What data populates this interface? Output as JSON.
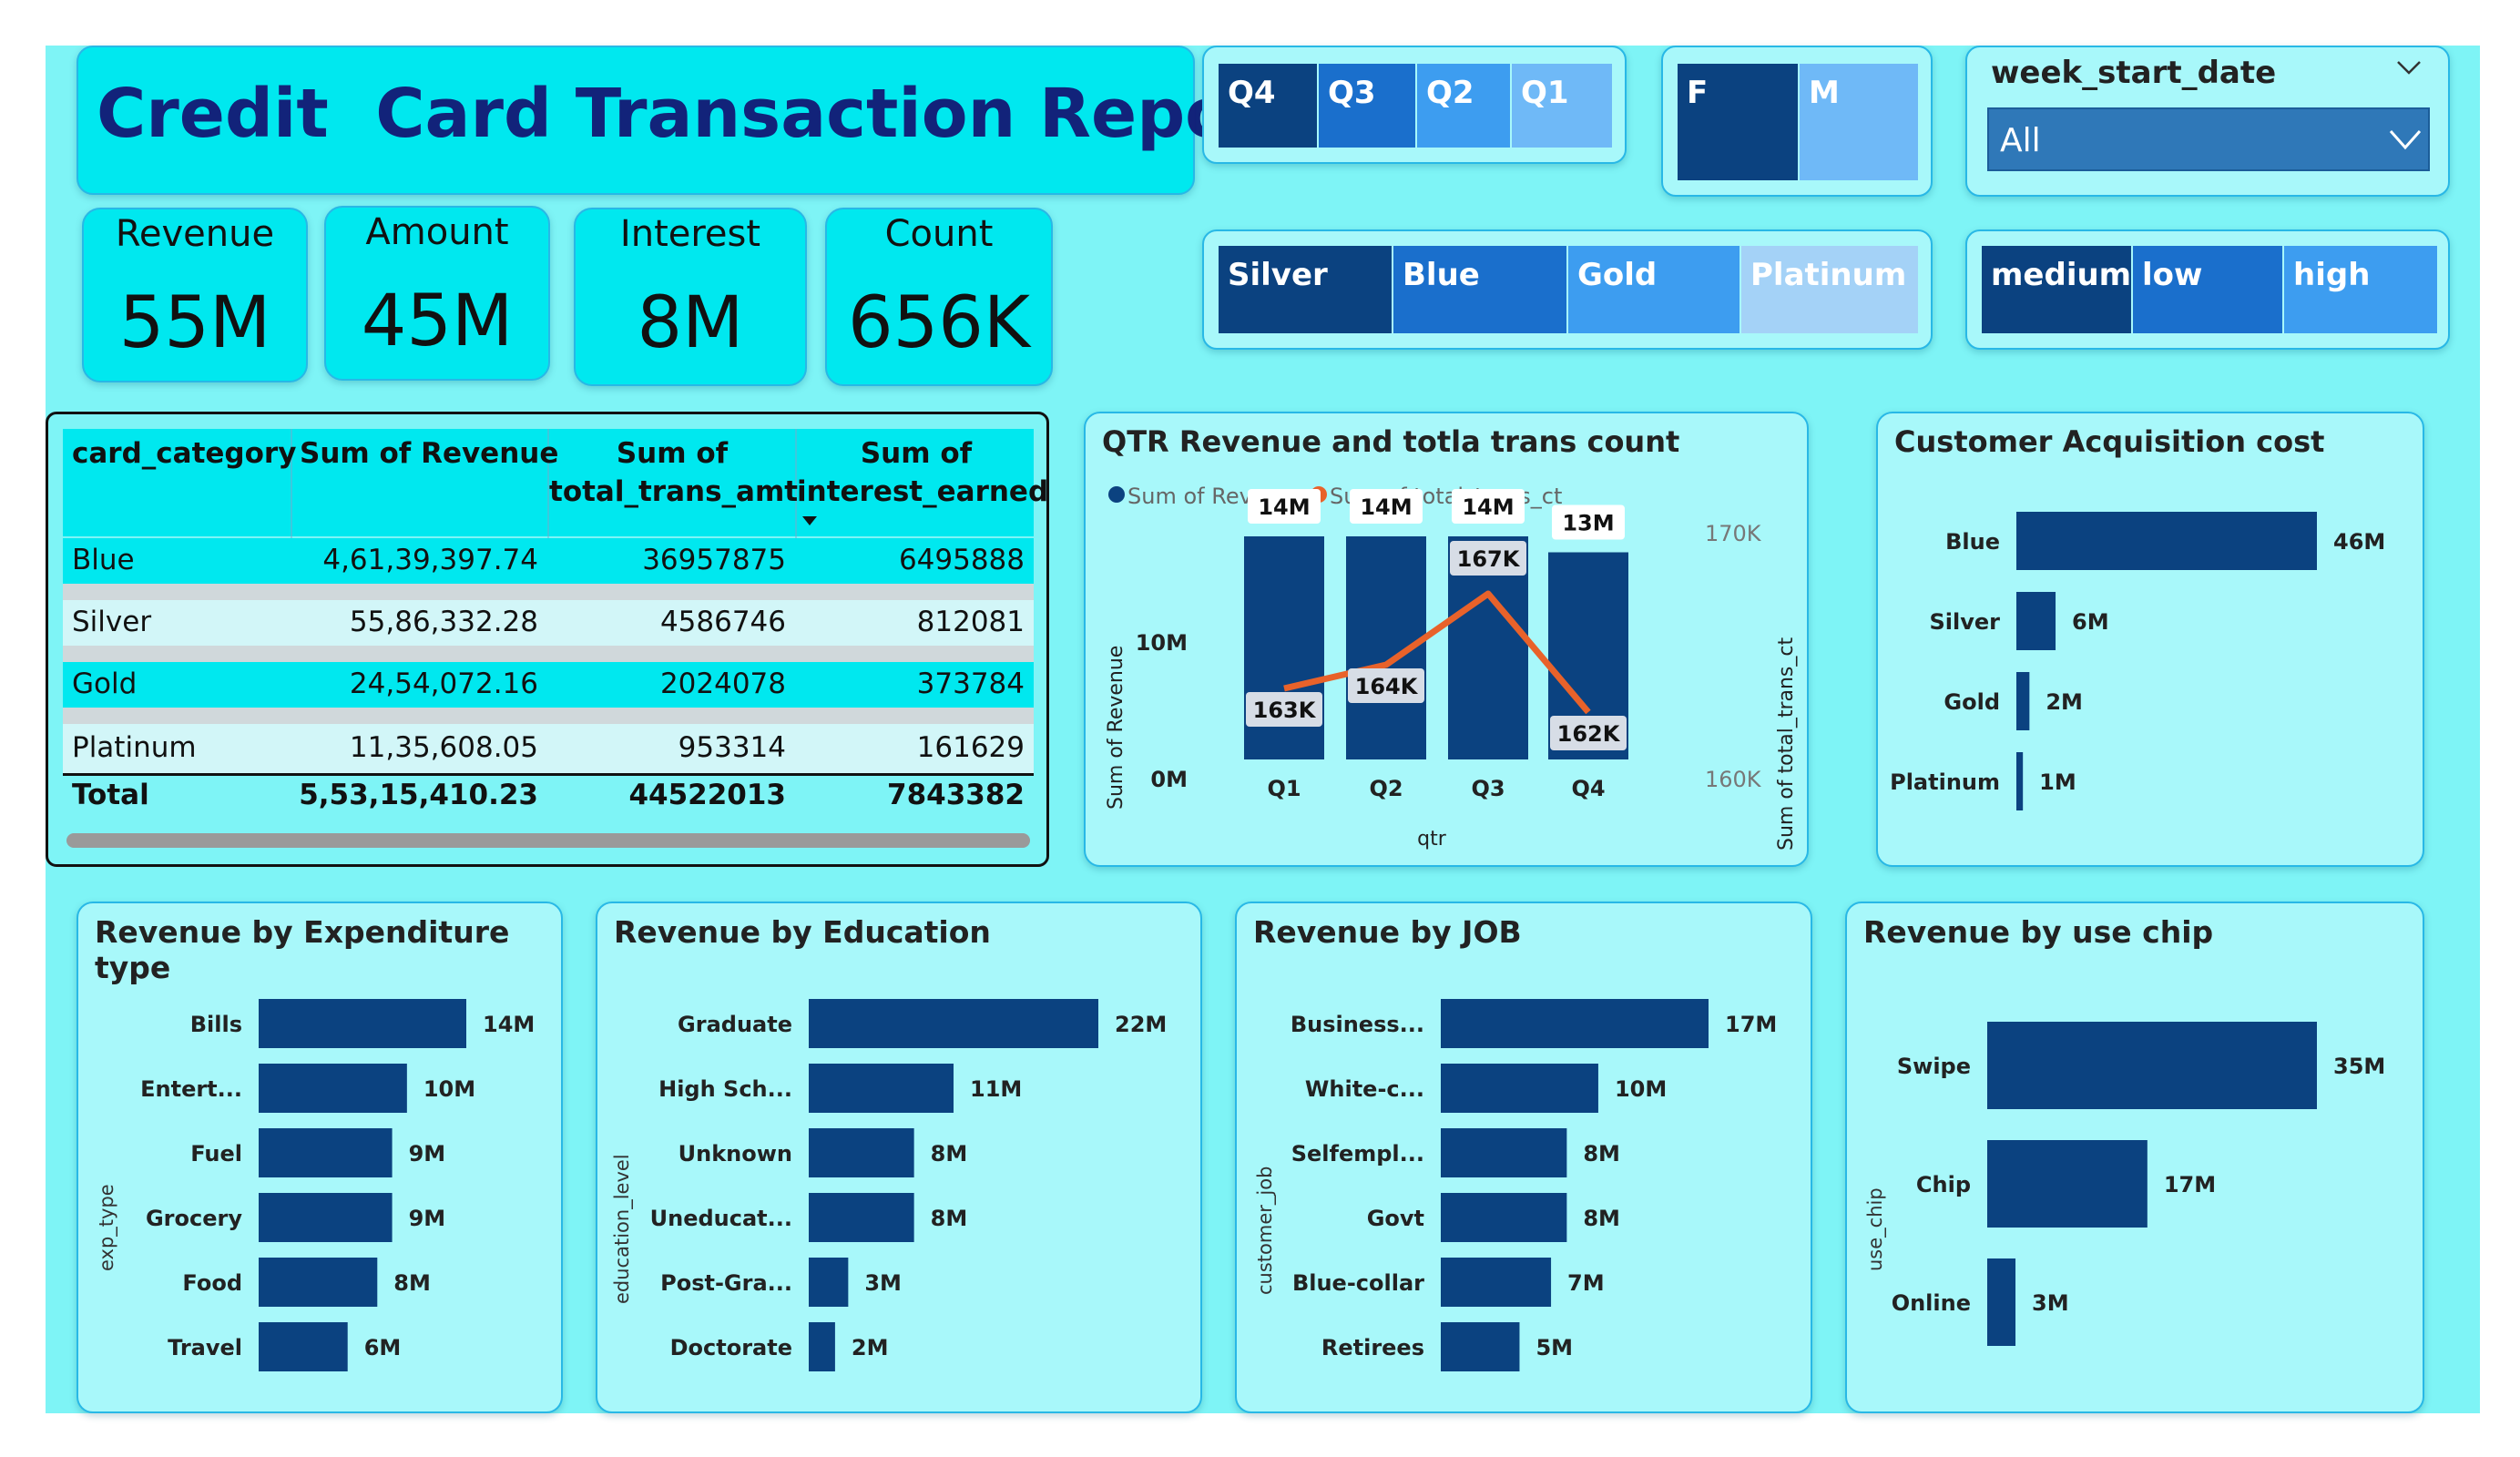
{
  "report_title": "Credit  Card Transaction Report",
  "kpis": [
    {
      "label": "Revenue",
      "value": "55M"
    },
    {
      "label": "Amount",
      "value": "45M"
    },
    {
      "label": "Interest",
      "value": "8M"
    },
    {
      "label": "Count",
      "value": "656K"
    }
  ],
  "slicers": {
    "quarters": [
      "Q4",
      "Q3",
      "Q2",
      "Q1"
    ],
    "gender": [
      "F",
      "M"
    ],
    "week": {
      "title": "week_start_date",
      "value": "All"
    },
    "card_category": [
      "Silver",
      "Blue",
      "Gold",
      "Platinum"
    ],
    "income": [
      "medium",
      "low",
      "high"
    ]
  },
  "colors": {
    "dark_blue": "#0b4280",
    "mid_blue": "#1a6fcc",
    "light_blue": "#3d9df0",
    "pale_blue": "#6fb9f7",
    "palest_blue": "#a4d2f7",
    "orange": "#e8622a",
    "canvas": "#7ef4f6",
    "title_text": "#12237a"
  },
  "table": {
    "headers": [
      [
        "card_category"
      ],
      [
        "Sum of Revenue"
      ],
      [
        "Sum of",
        "total_trans_amt"
      ],
      [
        "Sum of",
        "interest_earned"
      ]
    ],
    "rows": [
      [
        "Blue",
        "4,61,39,397.74",
        "36957875",
        "6495888"
      ],
      [
        "Silver",
        "55,86,332.28",
        "4586746",
        "812081"
      ],
      [
        "Gold",
        "24,54,072.16",
        "2024078",
        "373784"
      ],
      [
        "Platinum",
        "11,35,608.05",
        "953314",
        "161629"
      ]
    ],
    "total": [
      "Total",
      "5,53,15,410.23",
      "44522013",
      "7843382"
    ]
  },
  "qtr_chart": {
    "title": "QTR Revenue and totla trans count",
    "legend": [
      "Sum of Revenue",
      "Sum of total_trans_ct"
    ],
    "left_axis_title": "Sum of Revenue",
    "right_axis_title": "Sum of total_trans_ct",
    "x_axis_title": "qtr",
    "left_ticks": [
      "0M",
      "10M"
    ],
    "right_ticks": [
      "160K",
      "170K"
    ]
  },
  "cac_chart": {
    "title": "Customer Acquisition cost"
  },
  "exp_chart": {
    "title": "Revenue by Expenditure type",
    "axis_title": "exp_type"
  },
  "edu_chart": {
    "title": "Revenue by Education",
    "axis_title": "education_level"
  },
  "job_chart": {
    "title": "Revenue by JOB",
    "axis_title": "customer_job"
  },
  "chip_chart": {
    "title": "Revenue by use chip",
    "axis_title": "use_chip"
  },
  "chart_data": [
    {
      "type": "bar",
      "title": "QTR Revenue and totla trans count",
      "categories": [
        "Q1",
        "Q2",
        "Q3",
        "Q4"
      ],
      "series": [
        {
          "name": "Sum of Revenue",
          "values": [
            14,
            14,
            14,
            13
          ],
          "labels": [
            "14M",
            "14M",
            "14M",
            "13M"
          ],
          "unit": "M"
        },
        {
          "name": "Sum of total_trans_ct",
          "chart": "line",
          "values": [
            163,
            164,
            167,
            162
          ],
          "labels": [
            "163K",
            "164K",
            "167K",
            "162K"
          ],
          "unit": "K"
        }
      ],
      "ylim": [
        0,
        16
      ],
      "y2lim": [
        160,
        170
      ]
    },
    {
      "type": "bar",
      "orientation": "horizontal",
      "title": "Customer Acquisition cost",
      "categories": [
        "Blue",
        "Silver",
        "Gold",
        "Platinum"
      ],
      "values": [
        46,
        6,
        2,
        1
      ],
      "labels": [
        "46M",
        "6M",
        "2M",
        "1M"
      ]
    },
    {
      "type": "bar",
      "orientation": "horizontal",
      "title": "Revenue by Expenditure type",
      "categories": [
        "Bills",
        "Entert...",
        "Fuel",
        "Grocery",
        "Food",
        "Travel"
      ],
      "values": [
        14,
        10,
        9,
        9,
        8,
        6
      ],
      "labels": [
        "14M",
        "10M",
        "9M",
        "9M",
        "8M",
        "6M"
      ]
    },
    {
      "type": "bar",
      "orientation": "horizontal",
      "title": "Revenue by Education",
      "categories": [
        "Graduate",
        "High Sch...",
        "Unknown",
        "Uneducat...",
        "Post-Gra...",
        "Doctorate"
      ],
      "values": [
        22,
        11,
        8,
        8,
        3,
        2
      ],
      "labels": [
        "22M",
        "11M",
        "8M",
        "8M",
        "3M",
        "2M"
      ]
    },
    {
      "type": "bar",
      "orientation": "horizontal",
      "title": "Revenue by JOB",
      "categories": [
        "Business...",
        "White-c...",
        "Selfempl...",
        "Govt",
        "Blue-collar",
        "Retirees"
      ],
      "values": [
        17,
        10,
        8,
        8,
        7,
        5
      ],
      "labels": [
        "17M",
        "10M",
        "8M",
        "8M",
        "7M",
        "5M"
      ]
    },
    {
      "type": "bar",
      "orientation": "horizontal",
      "title": "Revenue by use chip",
      "categories": [
        "Swipe",
        "Chip",
        "Online"
      ],
      "values": [
        35,
        17,
        3
      ],
      "labels": [
        "35M",
        "17M",
        "3M"
      ]
    }
  ]
}
